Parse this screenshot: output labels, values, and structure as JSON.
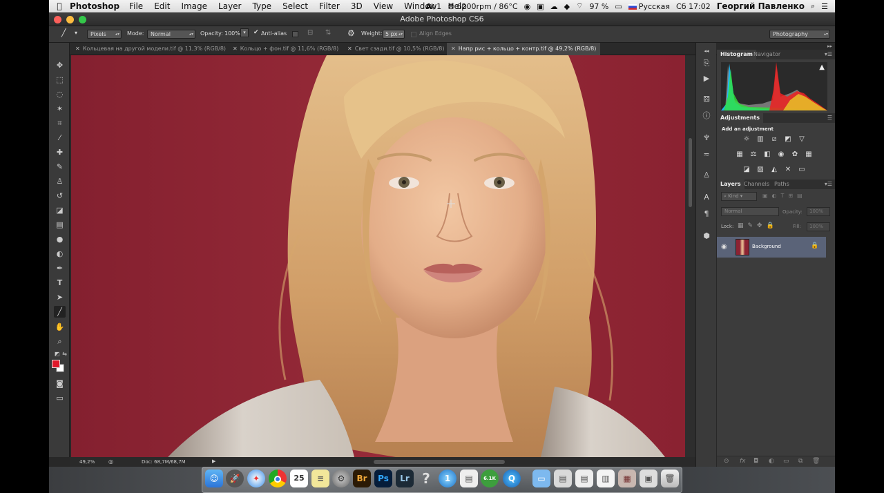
{
  "menubar": {
    "app_name": "Photoshop",
    "items": [
      "File",
      "Edit",
      "Image",
      "Layer",
      "Type",
      "Select",
      "Filter",
      "3D",
      "View",
      "Window",
      "Help"
    ],
    "status": {
      "adobe": "1",
      "fan": "6200rpm / 86°C",
      "battery": "97 %",
      "input_lang": "Русская",
      "clock": "Сб 17:02",
      "user": "Георгий Павленко"
    }
  },
  "window": {
    "title": "Adobe Photoshop CS6"
  },
  "options": {
    "mode_prefix": "Pixels",
    "mode_label": "Mode:",
    "mode_value": "Normal",
    "opacity_label": "Opacity:",
    "opacity_value": "100%",
    "antialias_label": "Anti-alias",
    "weight_label": "Weight:",
    "weight_value": "5 px",
    "align_edges_label": "Align Edges",
    "workspace": "Photography"
  },
  "tabs": [
    {
      "label": "Кольцевая на другой модели.tif @ 11,3% (RGB/8)"
    },
    {
      "label": "Кольцо + фон.tif @ 11,6% (RGB/8)"
    },
    {
      "label": "Свет сзади.tif @ 10,5% (RGB/8)"
    },
    {
      "label": "Напр рис + кольцо + контр.tif @ 49,2% (RGB/8)"
    }
  ],
  "status": {
    "zoom": "49,2%",
    "doc": "Doc: 68,7M/68,7M"
  },
  "panels": {
    "histogram_tab": "Histogram",
    "navigator_tab": "Navigator",
    "adjustments_tab": "Adjustments",
    "add_adjustment": "Add an adjustment",
    "layers_tab": "Layers",
    "channels_tab": "Channels",
    "paths_tab": "Paths",
    "kind_label": "Kind",
    "blend_mode": "Normal",
    "opacity_label": "Opacity:",
    "opacity_value": "100%",
    "lock_label": "Lock:",
    "fill_label": "Fill:",
    "fill_value": "100%",
    "layer_name": "Background"
  },
  "dock": {
    "calendar_day": "25",
    "bridge": "Br",
    "photoshop": "Ps",
    "lightroom": "Lr",
    "utorrent_badge": "6.1K"
  },
  "colors": {
    "foreground": "#e0182a",
    "background": "#ffffff",
    "canvas_bg": "#8c2333"
  }
}
